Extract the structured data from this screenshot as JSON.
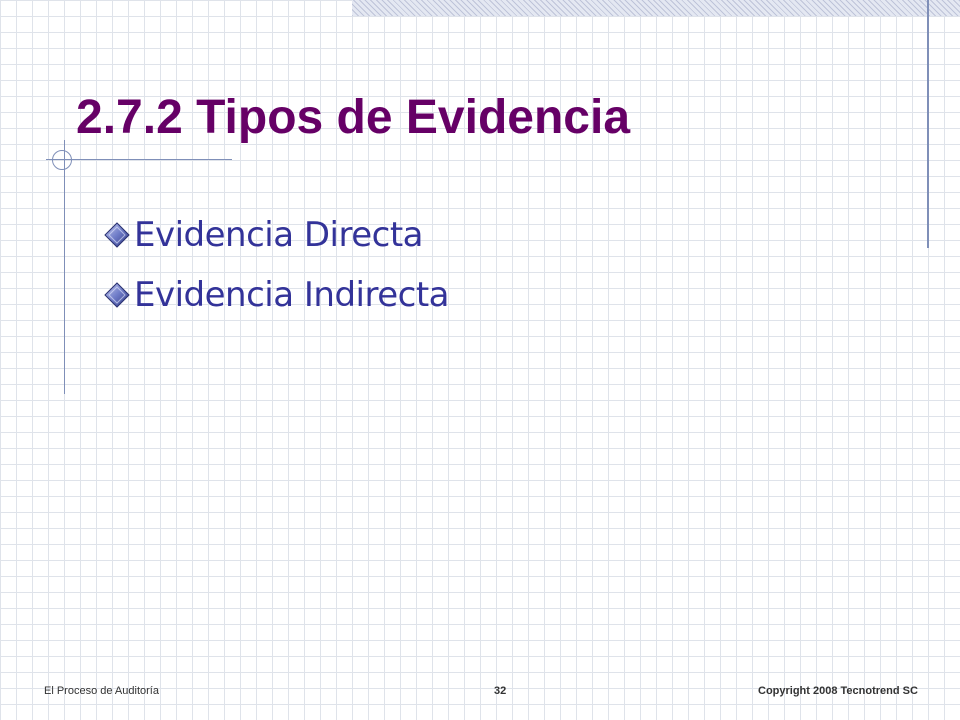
{
  "slide": {
    "title": "2.7.2 Tipos de Evidencia",
    "bullets": [
      {
        "label": "Evidencia Directa"
      },
      {
        "label": "Evidencia Indirecta"
      }
    ]
  },
  "footer": {
    "left": "El Proceso de Auditoría",
    "page_number": "32",
    "right": "Copyright  2008 Tecnotrend SC"
  },
  "colors": {
    "title": "#660066",
    "bullet_text": "#333399",
    "accent_lines": "#7f8fb8",
    "grid": "#dfe3ea"
  },
  "icons": {
    "bullet": "diamond-bullet-icon"
  }
}
